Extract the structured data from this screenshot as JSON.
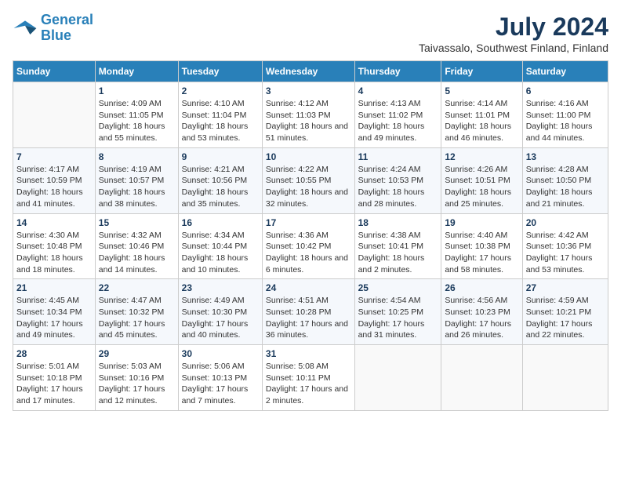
{
  "header": {
    "logo_line1": "General",
    "logo_line2": "Blue",
    "title": "July 2024",
    "location": "Taivassalo, Southwest Finland, Finland"
  },
  "days_of_week": [
    "Sunday",
    "Monday",
    "Tuesday",
    "Wednesday",
    "Thursday",
    "Friday",
    "Saturday"
  ],
  "weeks": [
    [
      {
        "num": "",
        "sunrise": "",
        "sunset": "",
        "daylight": ""
      },
      {
        "num": "1",
        "sunrise": "Sunrise: 4:09 AM",
        "sunset": "Sunset: 11:05 PM",
        "daylight": "Daylight: 18 hours and 55 minutes."
      },
      {
        "num": "2",
        "sunrise": "Sunrise: 4:10 AM",
        "sunset": "Sunset: 11:04 PM",
        "daylight": "Daylight: 18 hours and 53 minutes."
      },
      {
        "num": "3",
        "sunrise": "Sunrise: 4:12 AM",
        "sunset": "Sunset: 11:03 PM",
        "daylight": "Daylight: 18 hours and 51 minutes."
      },
      {
        "num": "4",
        "sunrise": "Sunrise: 4:13 AM",
        "sunset": "Sunset: 11:02 PM",
        "daylight": "Daylight: 18 hours and 49 minutes."
      },
      {
        "num": "5",
        "sunrise": "Sunrise: 4:14 AM",
        "sunset": "Sunset: 11:01 PM",
        "daylight": "Daylight: 18 hours and 46 minutes."
      },
      {
        "num": "6",
        "sunrise": "Sunrise: 4:16 AM",
        "sunset": "Sunset: 11:00 PM",
        "daylight": "Daylight: 18 hours and 44 minutes."
      }
    ],
    [
      {
        "num": "7",
        "sunrise": "Sunrise: 4:17 AM",
        "sunset": "Sunset: 10:59 PM",
        "daylight": "Daylight: 18 hours and 41 minutes."
      },
      {
        "num": "8",
        "sunrise": "Sunrise: 4:19 AM",
        "sunset": "Sunset: 10:57 PM",
        "daylight": "Daylight: 18 hours and 38 minutes."
      },
      {
        "num": "9",
        "sunrise": "Sunrise: 4:21 AM",
        "sunset": "Sunset: 10:56 PM",
        "daylight": "Daylight: 18 hours and 35 minutes."
      },
      {
        "num": "10",
        "sunrise": "Sunrise: 4:22 AM",
        "sunset": "Sunset: 10:55 PM",
        "daylight": "Daylight: 18 hours and 32 minutes."
      },
      {
        "num": "11",
        "sunrise": "Sunrise: 4:24 AM",
        "sunset": "Sunset: 10:53 PM",
        "daylight": "Daylight: 18 hours and 28 minutes."
      },
      {
        "num": "12",
        "sunrise": "Sunrise: 4:26 AM",
        "sunset": "Sunset: 10:51 PM",
        "daylight": "Daylight: 18 hours and 25 minutes."
      },
      {
        "num": "13",
        "sunrise": "Sunrise: 4:28 AM",
        "sunset": "Sunset: 10:50 PM",
        "daylight": "Daylight: 18 hours and 21 minutes."
      }
    ],
    [
      {
        "num": "14",
        "sunrise": "Sunrise: 4:30 AM",
        "sunset": "Sunset: 10:48 PM",
        "daylight": "Daylight: 18 hours and 18 minutes."
      },
      {
        "num": "15",
        "sunrise": "Sunrise: 4:32 AM",
        "sunset": "Sunset: 10:46 PM",
        "daylight": "Daylight: 18 hours and 14 minutes."
      },
      {
        "num": "16",
        "sunrise": "Sunrise: 4:34 AM",
        "sunset": "Sunset: 10:44 PM",
        "daylight": "Daylight: 18 hours and 10 minutes."
      },
      {
        "num": "17",
        "sunrise": "Sunrise: 4:36 AM",
        "sunset": "Sunset: 10:42 PM",
        "daylight": "Daylight: 18 hours and 6 minutes."
      },
      {
        "num": "18",
        "sunrise": "Sunrise: 4:38 AM",
        "sunset": "Sunset: 10:41 PM",
        "daylight": "Daylight: 18 hours and 2 minutes."
      },
      {
        "num": "19",
        "sunrise": "Sunrise: 4:40 AM",
        "sunset": "Sunset: 10:38 PM",
        "daylight": "Daylight: 17 hours and 58 minutes."
      },
      {
        "num": "20",
        "sunrise": "Sunrise: 4:42 AM",
        "sunset": "Sunset: 10:36 PM",
        "daylight": "Daylight: 17 hours and 53 minutes."
      }
    ],
    [
      {
        "num": "21",
        "sunrise": "Sunrise: 4:45 AM",
        "sunset": "Sunset: 10:34 PM",
        "daylight": "Daylight: 17 hours and 49 minutes."
      },
      {
        "num": "22",
        "sunrise": "Sunrise: 4:47 AM",
        "sunset": "Sunset: 10:32 PM",
        "daylight": "Daylight: 17 hours and 45 minutes."
      },
      {
        "num": "23",
        "sunrise": "Sunrise: 4:49 AM",
        "sunset": "Sunset: 10:30 PM",
        "daylight": "Daylight: 17 hours and 40 minutes."
      },
      {
        "num": "24",
        "sunrise": "Sunrise: 4:51 AM",
        "sunset": "Sunset: 10:28 PM",
        "daylight": "Daylight: 17 hours and 36 minutes."
      },
      {
        "num": "25",
        "sunrise": "Sunrise: 4:54 AM",
        "sunset": "Sunset: 10:25 PM",
        "daylight": "Daylight: 17 hours and 31 minutes."
      },
      {
        "num": "26",
        "sunrise": "Sunrise: 4:56 AM",
        "sunset": "Sunset: 10:23 PM",
        "daylight": "Daylight: 17 hours and 26 minutes."
      },
      {
        "num": "27",
        "sunrise": "Sunrise: 4:59 AM",
        "sunset": "Sunset: 10:21 PM",
        "daylight": "Daylight: 17 hours and 22 minutes."
      }
    ],
    [
      {
        "num": "28",
        "sunrise": "Sunrise: 5:01 AM",
        "sunset": "Sunset: 10:18 PM",
        "daylight": "Daylight: 17 hours and 17 minutes."
      },
      {
        "num": "29",
        "sunrise": "Sunrise: 5:03 AM",
        "sunset": "Sunset: 10:16 PM",
        "daylight": "Daylight: 17 hours and 12 minutes."
      },
      {
        "num": "30",
        "sunrise": "Sunrise: 5:06 AM",
        "sunset": "Sunset: 10:13 PM",
        "daylight": "Daylight: 17 hours and 7 minutes."
      },
      {
        "num": "31",
        "sunrise": "Sunrise: 5:08 AM",
        "sunset": "Sunset: 10:11 PM",
        "daylight": "Daylight: 17 hours and 2 minutes."
      },
      {
        "num": "",
        "sunrise": "",
        "sunset": "",
        "daylight": ""
      },
      {
        "num": "",
        "sunrise": "",
        "sunset": "",
        "daylight": ""
      },
      {
        "num": "",
        "sunrise": "",
        "sunset": "",
        "daylight": ""
      }
    ]
  ]
}
